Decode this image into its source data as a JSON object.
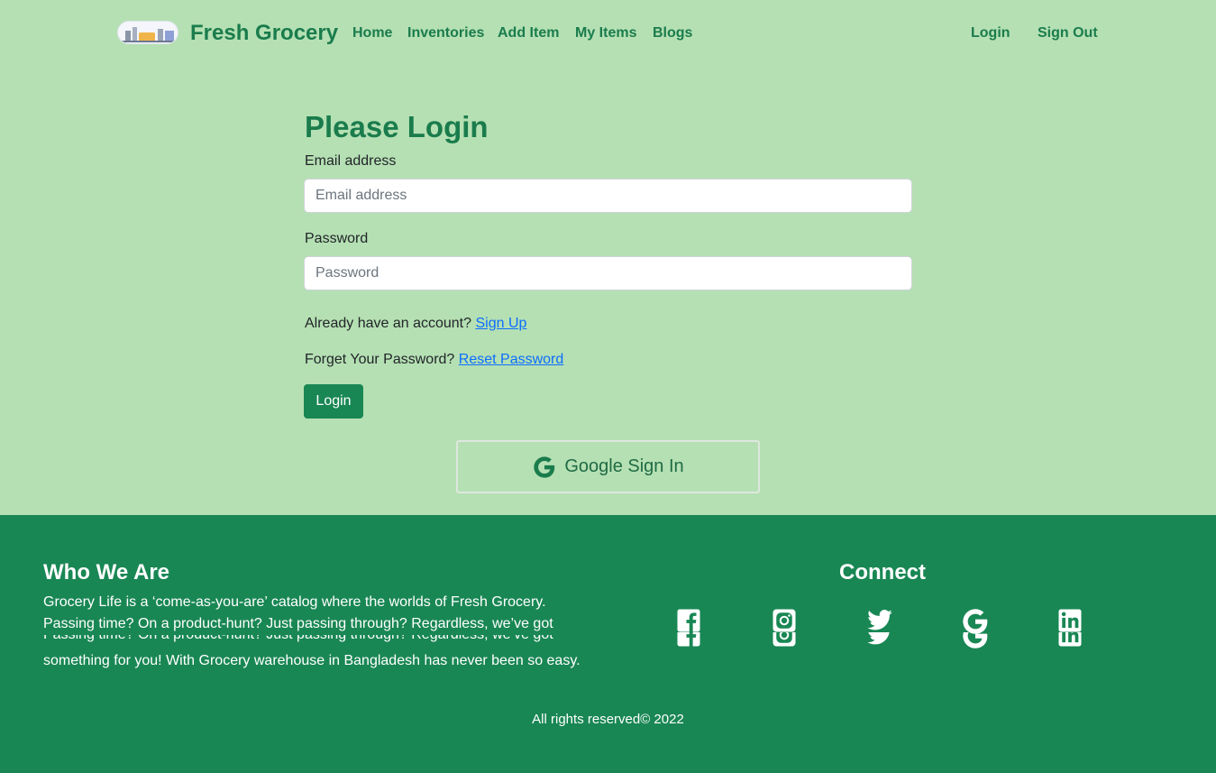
{
  "brand": {
    "name": "Fresh Grocery",
    "logo": "warehouse-logo"
  },
  "nav": {
    "home": "Home",
    "inventories": "Inventories",
    "add_item": "Add Item",
    "my_items": "My Items",
    "blogs": "Blogs",
    "login": "Login",
    "sign_out": "Sign Out"
  },
  "form": {
    "title": "Please Login",
    "email_label": "Email address",
    "email_placeholder": "Email address",
    "email_value": "",
    "password_label": "Password",
    "password_placeholder": "Password",
    "password_value": "",
    "signup_prompt": "Already have an account?",
    "signup_link": "Sign Up",
    "reset_prompt": "Forget Your Password?",
    "reset_link": "Reset Password",
    "login_button": "Login",
    "google_button": "Google Sign In"
  },
  "footer": {
    "who_title": "Who We Are",
    "who_line1": "Grocery Life is a ‘come-as-you-are’ catalog where the worlds of Fresh Grocery.",
    "who_line2": "Passing time? On a product-hunt? Just passing through? Regardless, we’ve got",
    "who_line3": "something for you! With Grocery warehouse in Bangladesh has never been so easy.",
    "connect_title": "Connect",
    "socials": [
      "facebook-icon",
      "instagram-icon",
      "twitter-icon",
      "google-icon",
      "linkedin-icon"
    ],
    "copyright": "All rights reserved© 2022"
  },
  "colors": {
    "page_bg": "#b5e0b3",
    "brand_green": "#1a7c4c",
    "footer_bg": "#198754",
    "link_blue": "#0d6efd"
  }
}
